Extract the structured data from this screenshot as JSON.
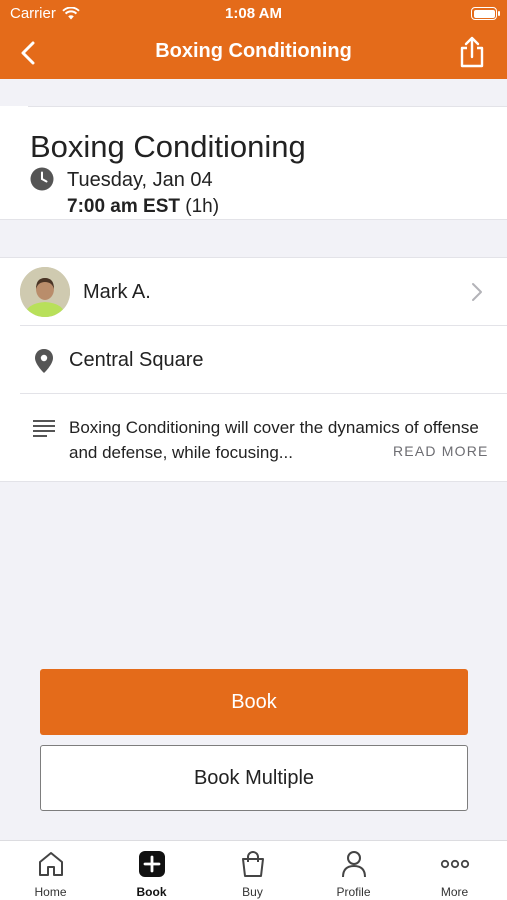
{
  "status_bar": {
    "carrier": "Carrier",
    "time": "1:08 AM"
  },
  "nav": {
    "title": "Boxing Conditioning",
    "back_icon": "chevron-left-icon",
    "share_icon": "share-icon"
  },
  "class_info": {
    "title": "Boxing Conditioning",
    "date": "Tuesday, Jan 04",
    "time": "7:00 am EST",
    "duration": "(1h)"
  },
  "instructor": {
    "name": "Mark A."
  },
  "location": {
    "name": "Central Square"
  },
  "description": {
    "text": "Boxing Conditioning will cover the dynamics of offense and defense, while focusing...",
    "read_more": "READ MORE"
  },
  "actions": {
    "book": "Book",
    "book_multiple": "Book Multiple"
  },
  "tabs": [
    {
      "label": "Home",
      "icon": "home-icon"
    },
    {
      "label": "Book",
      "icon": "plus-square-icon"
    },
    {
      "label": "Buy",
      "icon": "shopping-bag-icon"
    },
    {
      "label": "Profile",
      "icon": "person-icon"
    },
    {
      "label": "More",
      "icon": "more-dots-icon"
    }
  ],
  "colors": {
    "brand": "#e46b1a",
    "background": "#f2f2f7"
  }
}
